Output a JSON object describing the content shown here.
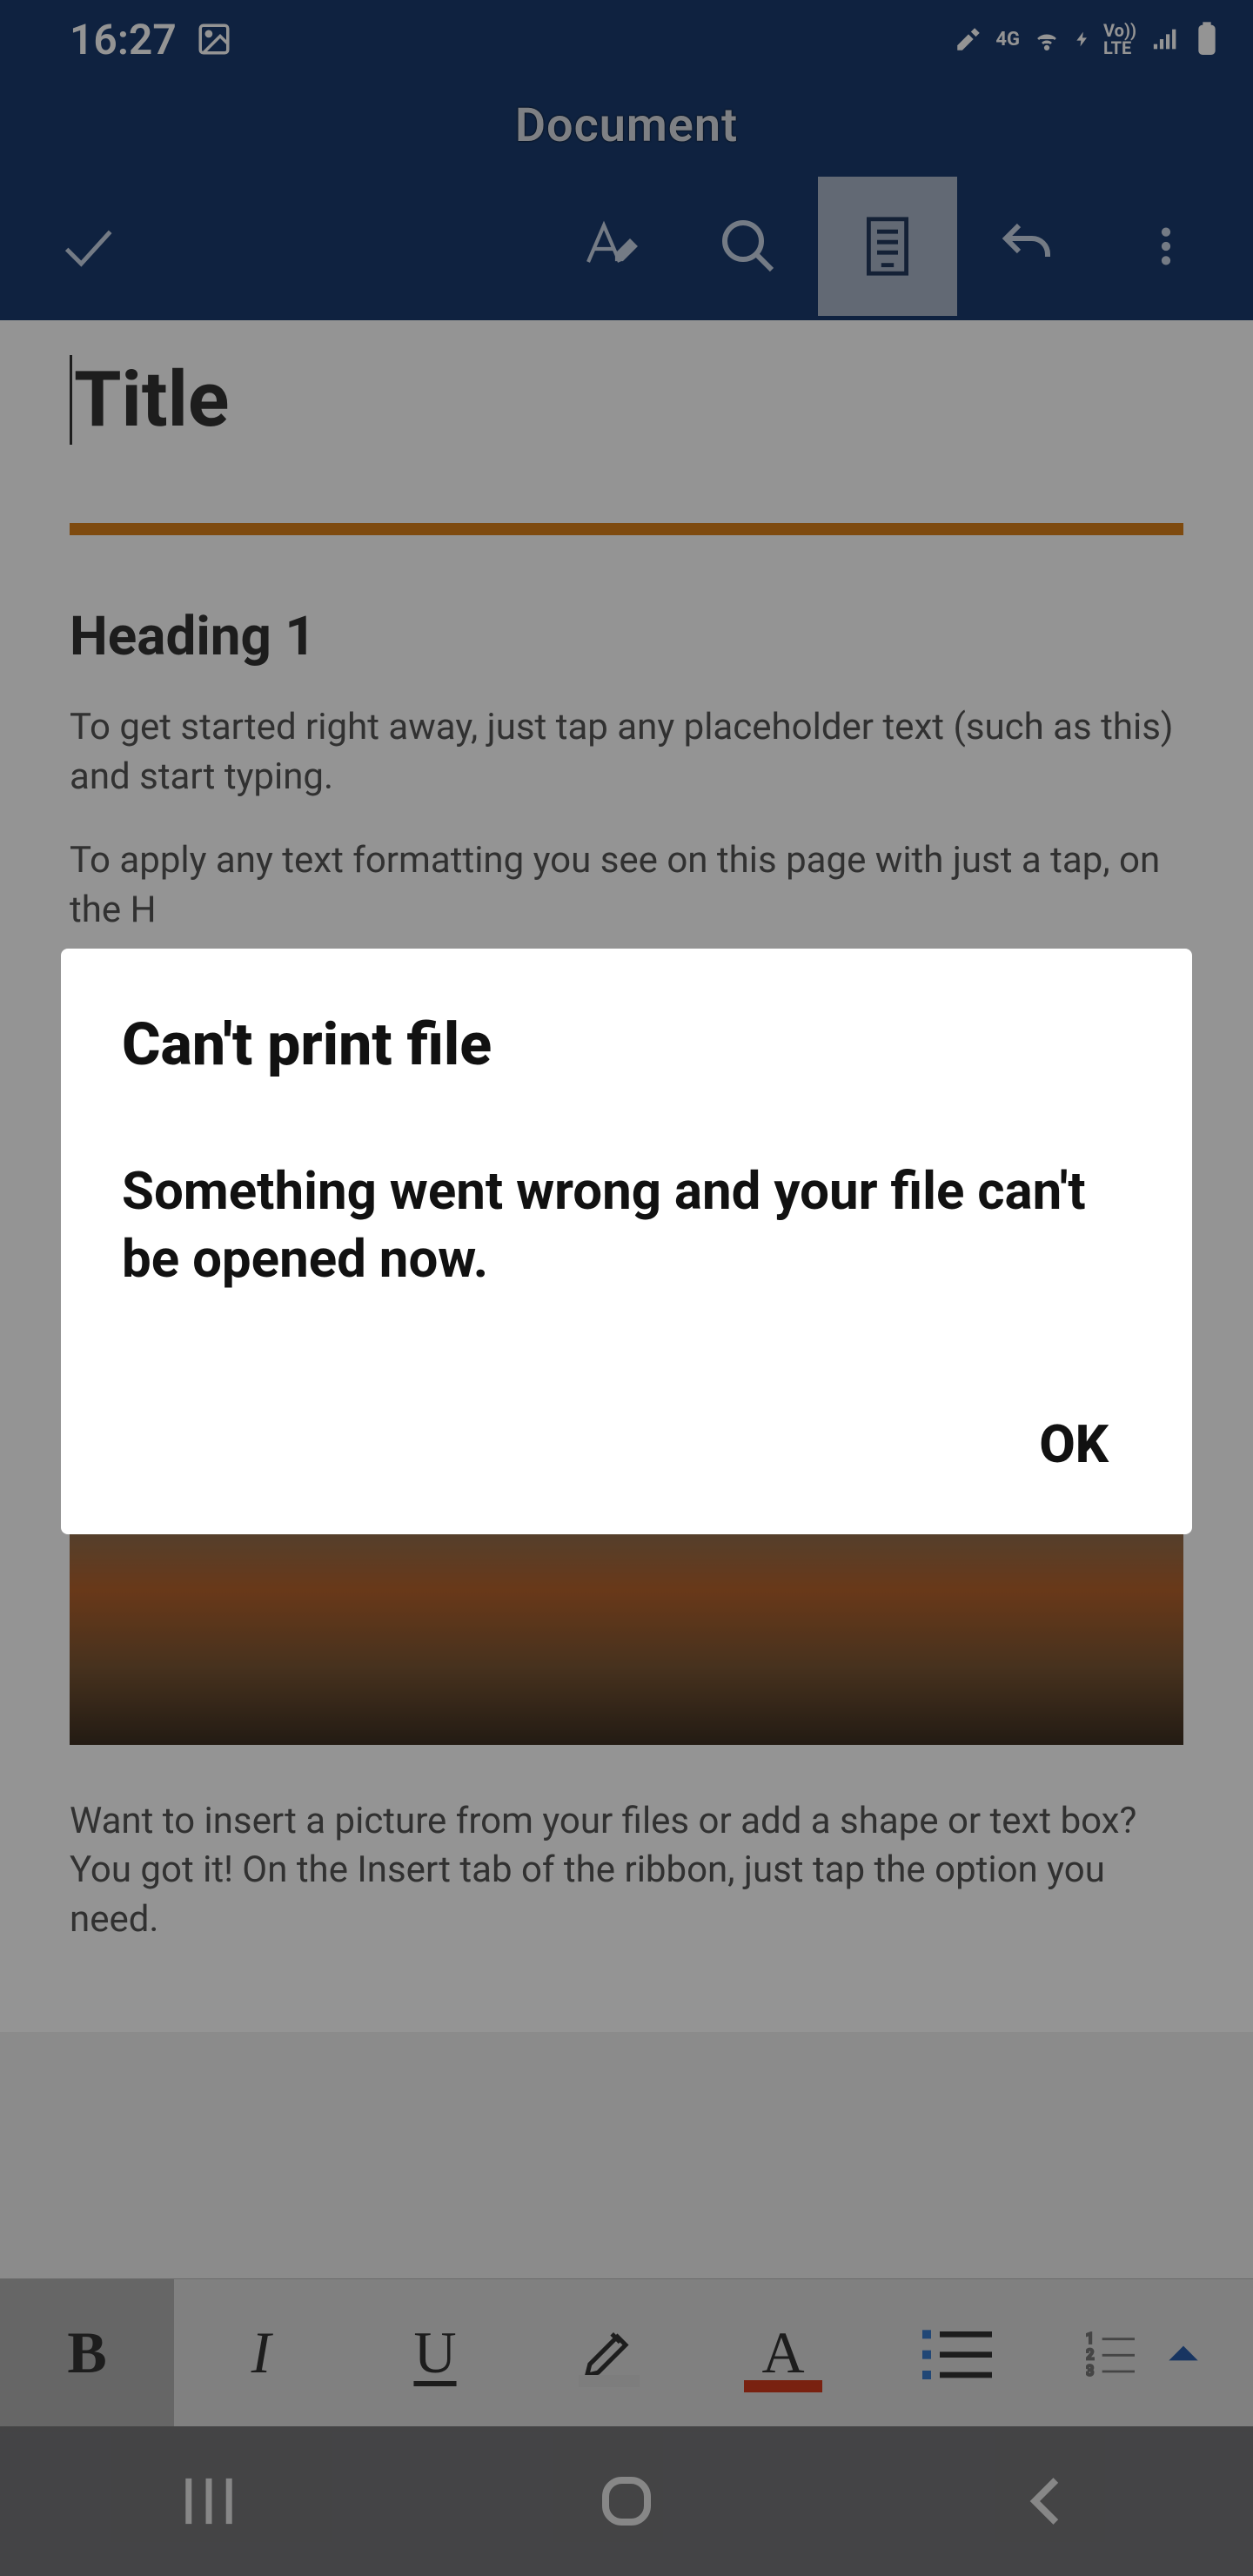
{
  "status": {
    "time": "16:27",
    "net_label": "4G",
    "lte_label": "LTE",
    "vo_label": "Vo))"
  },
  "header": {
    "title": "Document"
  },
  "toolbar": {
    "confirm_icon": "check",
    "draw_icon": "pen-a",
    "search_icon": "search",
    "reading_icon": "reading-view",
    "undo_icon": "undo",
    "more_icon": "more-vertical"
  },
  "document": {
    "title": "Title",
    "heading1": "Heading 1",
    "para1": "To get started right away, just tap any placeholder text (such as this) and start typing.",
    "para2": "To apply any text formatting you see on this page with just a tap, on the H",
    "para3": "Want to insert a picture from your files or add a shape or text box? You got it! On the Insert tab of the ribbon, just tap the option you need."
  },
  "format_bar": {
    "bold": "B",
    "italic": "I",
    "underline": "U",
    "font_letter": "A"
  },
  "dialog": {
    "title": "Can't print file",
    "message": "Something went wrong and your file can't be opened now.",
    "ok": "OK"
  }
}
